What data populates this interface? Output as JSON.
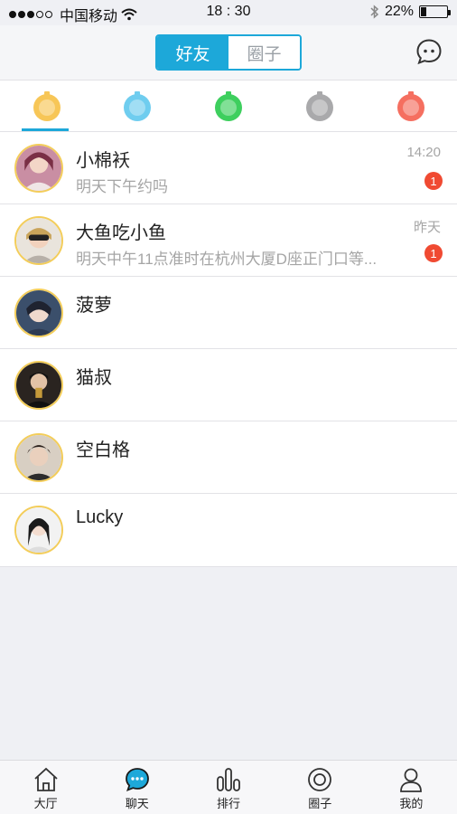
{
  "status_bar": {
    "carrier": "中国移动",
    "time": "18 : 30",
    "battery_percent": "22%",
    "battery_level": 0.22,
    "signal_bars_filled": 3,
    "signal_bars_total": 5
  },
  "header": {
    "tabs": [
      {
        "label": "好友",
        "active": true
      },
      {
        "label": "圈子",
        "active": false
      }
    ]
  },
  "mood_colors": [
    "#f7c657",
    "#6fcdef",
    "#3ecf5e",
    "#a9a9ab",
    "#f56f60"
  ],
  "chats": [
    {
      "name": "小棉袄",
      "message": "明天下午约吗",
      "time": "14:20",
      "badge": "1"
    },
    {
      "name": "大鱼吃小鱼",
      "message": "明天中午11点准时在杭州大厦D座正门口等...",
      "time": "昨天",
      "badge": "1"
    },
    {
      "name": "菠萝",
      "message": "",
      "time": "",
      "badge": ""
    },
    {
      "name": "猫叔",
      "message": "",
      "time": "",
      "badge": ""
    },
    {
      "name": "空白格",
      "message": "",
      "time": "",
      "badge": ""
    },
    {
      "name": "Lucky",
      "message": "",
      "time": "",
      "badge": ""
    }
  ],
  "tabbar": {
    "items": [
      {
        "label": "大厅",
        "icon": "home-icon"
      },
      {
        "label": "聊天",
        "icon": "chat-icon",
        "active": true
      },
      {
        "label": "排行",
        "icon": "ranking-icon"
      },
      {
        "label": "圈子",
        "icon": "circle-icon"
      },
      {
        "label": "我的",
        "icon": "profile-icon"
      }
    ]
  },
  "colors": {
    "accent": "#1da8d9",
    "badge": "#f04a32",
    "avatar_ring": "#f3cd5a"
  }
}
